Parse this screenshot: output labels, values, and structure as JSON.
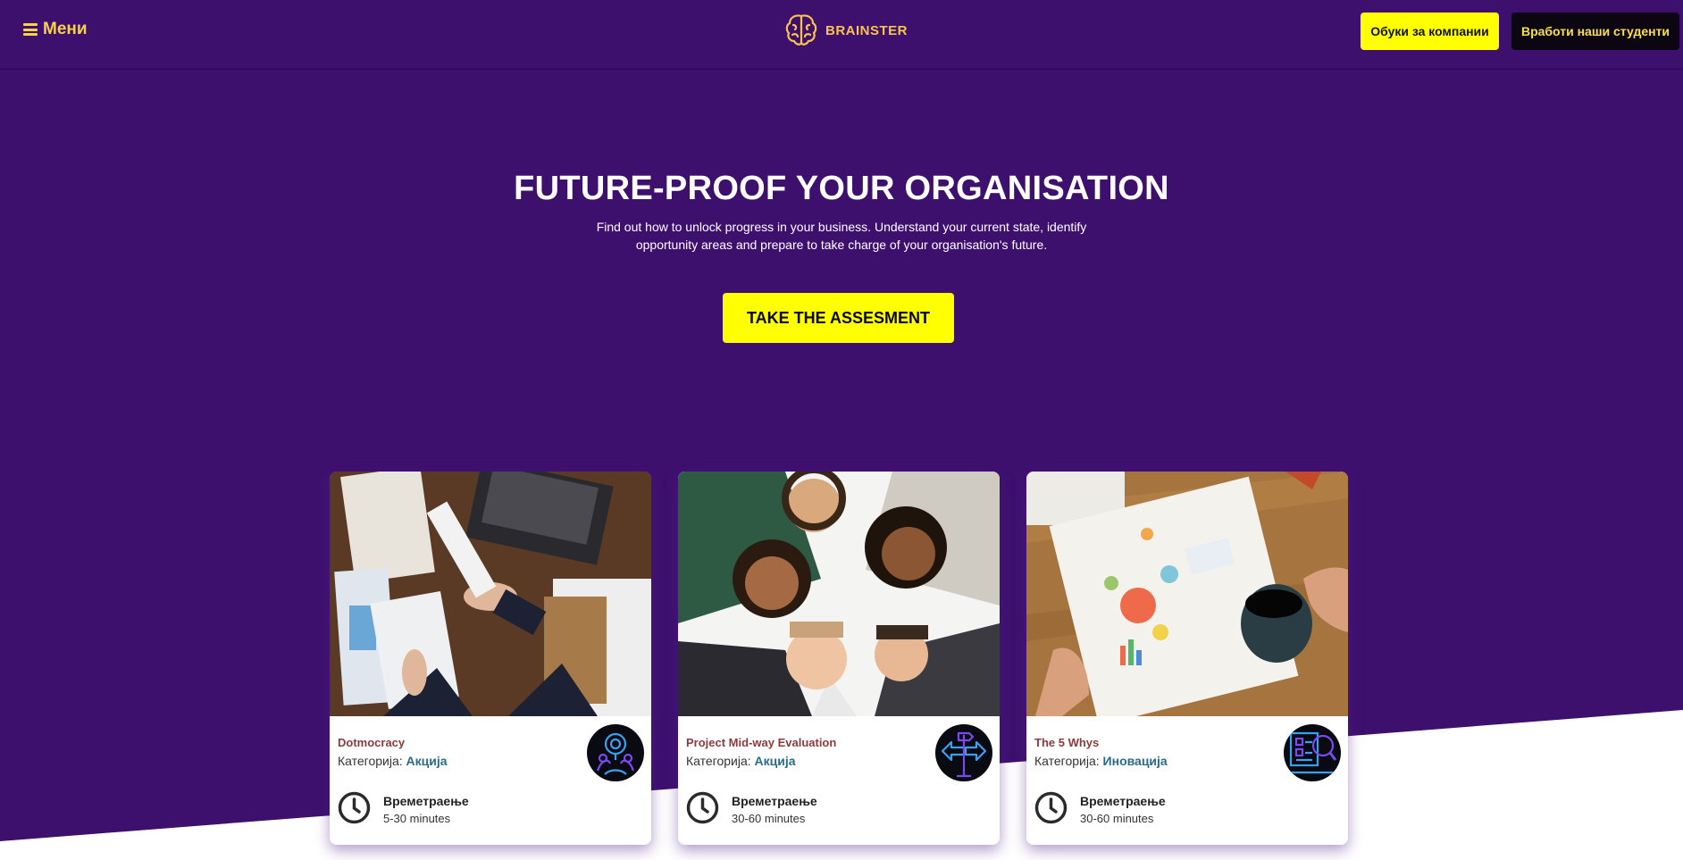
{
  "nav": {
    "menu_label": "Мени",
    "logo_text": "BRAINSTER",
    "companies_button": "Обуки за компании",
    "hire_button": "Вработи наши студенти"
  },
  "hero": {
    "title": "FUTURE-PROOF YOUR ORGANISATION",
    "subtitle": "Find out how to unlock progress in your business. Understand your current state, identify opportunity areas and prepare to take charge of your organisation's future.",
    "cta_label": "TAKE THE ASSESMENT"
  },
  "cards": [
    {
      "title": "Dotmocracy",
      "category_prefix": "Категорија:",
      "category": "Акција",
      "duration_label": "Времетраење",
      "duration": "5-30 minutes",
      "badge_icon": "location-people-icon",
      "image": "handshake-office-desk"
    },
    {
      "title": "Project Mid-way Evaluation",
      "category_prefix": "Категорија:",
      "category": "Акција",
      "duration_label": "Времетраење",
      "duration": "30-60 minutes",
      "badge_icon": "signpost-arrows-icon",
      "image": "team-circle-looking-down"
    },
    {
      "title": "The 5 Whys",
      "category_prefix": "Категорија:",
      "category": "Иновација",
      "duration_label": "Времетраење",
      "duration": "30-60 minutes",
      "badge_icon": "magnifier-analysis-icon",
      "image": "notebook-coffee-desk"
    }
  ],
  "colors": {
    "background": "#3e106e",
    "accent_yellow": "#ffff00",
    "logo_gold": "#f8c44a",
    "card_title": "#8a3b3b",
    "category_link": "#2a6a8a"
  }
}
